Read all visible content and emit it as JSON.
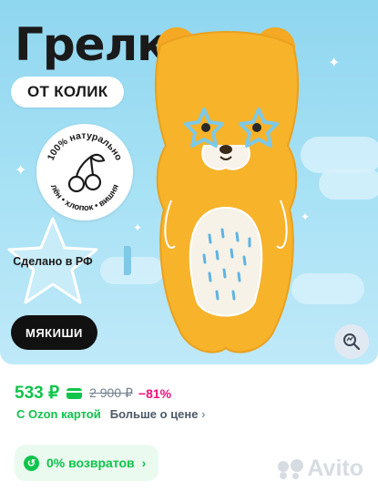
{
  "product": {
    "title": "Грелка",
    "subtitle": "ОТ КОЛИК",
    "natural_badge": {
      "top_text": "100% натурально",
      "bottom_text": "лён • хлопок • вишня",
      "icon": "cherry-icon"
    },
    "made_in": "Сделано в РФ",
    "brand": "МЯКИШИ"
  },
  "price": {
    "current": "533 ₽",
    "old": "2 900 ₽",
    "discount": "−81%",
    "card_label": "С Ozon картой",
    "more_label": "Больше о цене",
    "chevron": "›"
  },
  "returns": {
    "label": "0% возвратов",
    "chevron": "›"
  },
  "watermark": "Avito",
  "colors": {
    "hero_bg": "#a9e2f5",
    "bear": "#f7b32a",
    "accent_green": "#10c44c",
    "discount": "#f1117e",
    "muted": "#707f8d"
  }
}
